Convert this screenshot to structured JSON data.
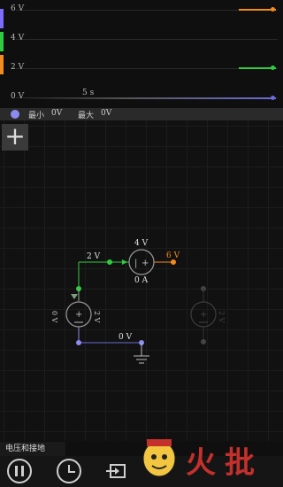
{
  "scope": {
    "v_labels": [
      "6 V",
      "4 V",
      "2 V",
      "0 V"
    ],
    "time_label": "5 s",
    "swatch_colors": [
      "#7b6cff",
      "#2ecc40",
      "#f28c1e"
    ]
  },
  "legend": {
    "min_label": "最小",
    "min_value": "0V",
    "max_label": "最大",
    "max_value": "0V",
    "dot_color": "#8a8cf0"
  },
  "add_icon": "+",
  "circuit": {
    "label_2v": "2 V",
    "label_4v": "4 V",
    "label_6v": "6 V",
    "label_0a": "0 A",
    "label_0v": "0 V",
    "src_left_v": "0 V",
    "src_left_v2": "2 V",
    "src_right_v": "2 V"
  },
  "hint": "电压和接地",
  "watermark": "火",
  "watermark2": "批"
}
